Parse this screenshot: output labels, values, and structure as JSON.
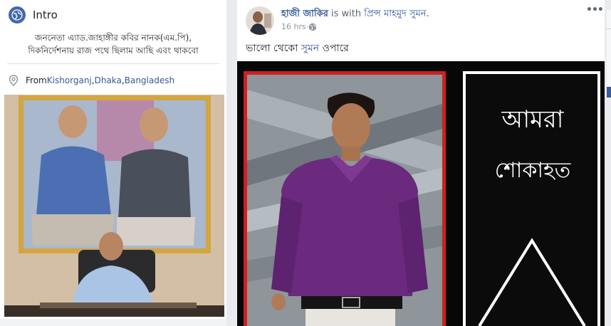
{
  "intro": {
    "title": "Intro",
    "bio_line1": "জননেতা এ্যাড.জাহাঙ্গীর কবির নানক(এম.পি),",
    "bio_line2": "দিকনির্দেশনায় রাজ পথে ছিলাম আছি এবং থাকবো",
    "from_prefix": "From ",
    "place1": "Kishorganj",
    "sep": ", ",
    "place2": "Dhaka",
    "place3": "Bangladesh"
  },
  "post": {
    "author": "হাজী জাকির",
    "is_with": " is with ",
    "tagged": "প্রিন্স মাহমুদ সুমন.",
    "time": "16 hrs",
    "dot": " · ",
    "more": "•••",
    "text_before": "ভালো থেকো ",
    "text_link": "সুমন",
    "text_after": " ওপারে",
    "banner_line1": "আমরা",
    "banner_line2": "শোকাহত"
  },
  "colors": {
    "link": "#365899",
    "fb_blue": "#4267b2",
    "red_frame": "#d11f1f",
    "shirt": "#6b2a7d"
  },
  "icons": [
    "globe-icon",
    "location-pin-icon",
    "public-audience-icon",
    "more-options-icon"
  ]
}
